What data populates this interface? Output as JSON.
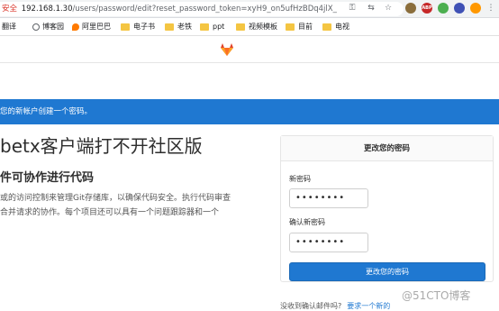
{
  "browser": {
    "security_label": "安全",
    "url_host": "192.168.1.30",
    "url_path": "/users/password/edit?reset_password_token=xyH9_on5ufHzBDq4jlX_",
    "key_icon": "key-icon",
    "star_icon": "star-icon"
  },
  "bookmarks": [
    {
      "label": "翻译",
      "icon": "globe-icon"
    },
    {
      "label": "博客园",
      "icon": "globe-icon"
    },
    {
      "label": "阿里巴巴",
      "icon": "fire-icon"
    },
    {
      "label": "电子书",
      "icon": "folder-icon"
    },
    {
      "label": "老铁",
      "icon": "folder-icon"
    },
    {
      "label": "ppt",
      "icon": "folder-icon"
    },
    {
      "label": "视频模板",
      "icon": "folder-icon"
    },
    {
      "label": "目前",
      "icon": "folder-icon"
    },
    {
      "label": "电视",
      "icon": "folder-icon"
    }
  ],
  "flash": {
    "message": "您的新帐户创建一个密码。"
  },
  "brand": {
    "title": "betx客户端打不开社区版",
    "subtitle": "件可协作进行代码",
    "desc_line1": "或的访问控制来管理Git存储库，以确保代码安全。执行代码审查",
    "desc_line2": "合并请求的协作。每个项目还可以具有一个问题跟踪器和一个"
  },
  "form": {
    "heading": "更改您的密码",
    "new_password_label": "新密码",
    "new_password_value": "••••••••",
    "confirm_password_label": "确认新密码",
    "confirm_password_value": "••••••••",
    "submit_label": "更改您的密码"
  },
  "footer": {
    "question": "没收到确认邮件吗?",
    "link": "要求一个新的"
  },
  "watermark": "@51CTO博客",
  "colors": {
    "primary": "#1f78d1",
    "gitlab_orange": "#e24329"
  }
}
